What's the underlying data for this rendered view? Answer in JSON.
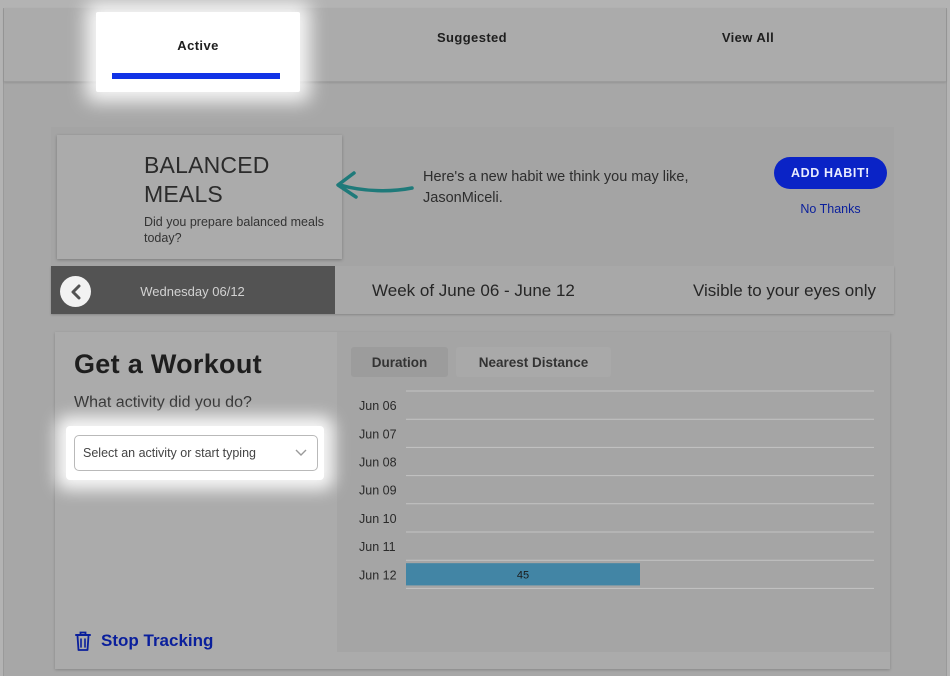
{
  "tabs": [
    {
      "label": "Active",
      "active": true
    },
    {
      "label": "Suggested",
      "active": false
    },
    {
      "label": "View All",
      "active": false
    }
  ],
  "habit_suggestion": {
    "title_line1": "BALANCED",
    "title_line2": "MEALS",
    "question": "Did you prepare balanced meals today?",
    "message_line1": "Here's a new habit we think you may like,",
    "message_line2": "JasonMiceli.",
    "add_button_label": "ADD HABIT!",
    "dismiss_label": "No Thanks"
  },
  "date_bar": {
    "current_date": "Wednesday 06/12",
    "week_label": "Week of June 06 - June 12",
    "visibility": "Visible to your eyes only"
  },
  "workout": {
    "title": "Get a Workout",
    "question": "What activity did you do?",
    "select_placeholder": "Select an activity or start typing",
    "stop_tracking_label": "Stop Tracking"
  },
  "chart_tabs": [
    {
      "label": "Duration",
      "active": true
    },
    {
      "label": "Nearest Distance",
      "active": false
    }
  ],
  "colors": {
    "accent_blue": "#1133e6",
    "button_blue": "#0a23c6",
    "bar_color": "#4285a5",
    "date_bar_dark": "#535353"
  },
  "chart_data": {
    "type": "bar",
    "orientation": "horizontal",
    "categories": [
      "Jun 06",
      "Jun 07",
      "Jun 08",
      "Jun 09",
      "Jun 10",
      "Jun 11",
      "Jun 12"
    ],
    "values": [
      0,
      0,
      0,
      0,
      0,
      0,
      45
    ],
    "data_labels": [
      "",
      "",
      "",
      "",
      "",
      "",
      "45"
    ],
    "xlim": [
      0,
      90
    ],
    "grid": true
  }
}
